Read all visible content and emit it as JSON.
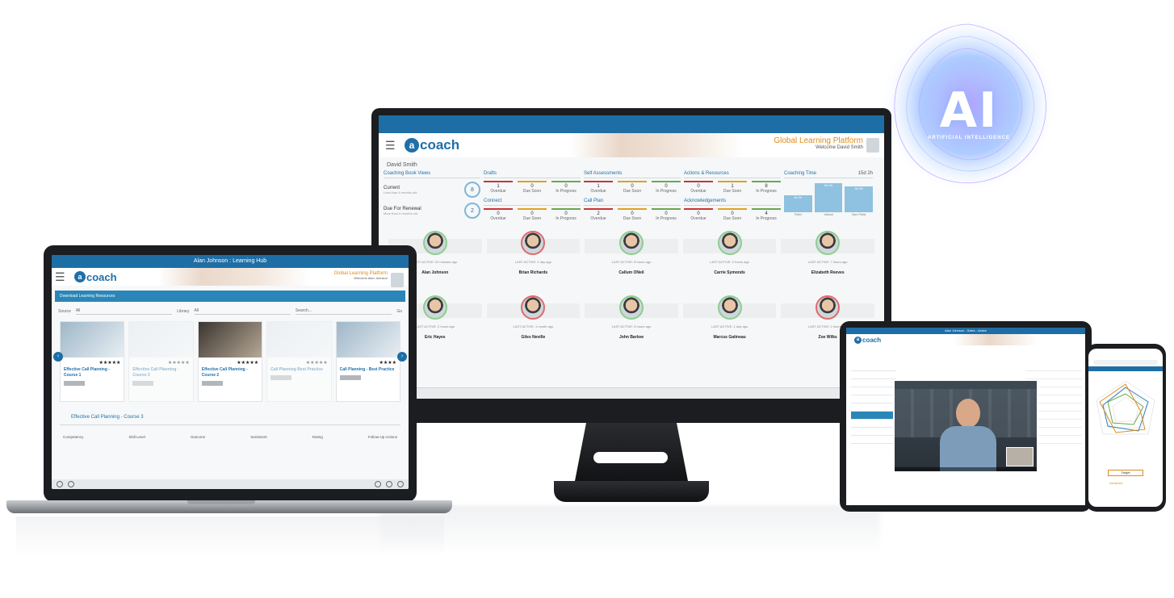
{
  "ai_badge": {
    "text": "AI",
    "subtitle": "ARTIFICIAL INTELLIGENCE"
  },
  "monitor": {
    "brand": {
      "logo_letter": "a",
      "logo_text": "coach",
      "platform": "Global Learning Platform",
      "welcome": "Welcome David Smith"
    },
    "user": "David Smith",
    "coaching_book": {
      "title": "Coaching Book Views",
      "items": [
        {
          "label": "Current",
          "sub": "Less than 6 months old",
          "count": "8"
        },
        {
          "label": "Due For Renewal",
          "sub": "More than 6 months old",
          "count": "2"
        }
      ]
    },
    "panels": [
      {
        "title": "Drafts",
        "stats": [
          {
            "n": "1",
            "l": "Overdue"
          },
          {
            "n": "0",
            "l": "Due Soon"
          },
          {
            "n": "0",
            "l": "In Progress"
          }
        ]
      },
      {
        "title": "Self Assessments",
        "stats": [
          {
            "n": "1",
            "l": "Overdue"
          },
          {
            "n": "0",
            "l": "Due Soon"
          },
          {
            "n": "0",
            "l": "In Progress"
          }
        ]
      },
      {
        "title": "Actions & Resources",
        "stats": [
          {
            "n": "0",
            "l": "Overdue"
          },
          {
            "n": "1",
            "l": "Due Soon"
          },
          {
            "n": "8",
            "l": "In Progress"
          }
        ]
      },
      {
        "title": "Connect",
        "stats": [
          {
            "n": "0",
            "l": "Overdue"
          },
          {
            "n": "0",
            "l": "Due Soon"
          },
          {
            "n": "0",
            "l": "In Progress"
          }
        ]
      },
      {
        "title": "Call Plan",
        "stats": [
          {
            "n": "2",
            "l": "Overdue"
          },
          {
            "n": "0",
            "l": "Due Soon"
          },
          {
            "n": "0",
            "l": "In Progress"
          }
        ]
      },
      {
        "title": "Acknowledgements",
        "stats": [
          {
            "n": "0",
            "l": "Overdue"
          },
          {
            "n": "0",
            "l": "Due Soon"
          },
          {
            "n": "4",
            "l": "In Progress"
          }
        ]
      }
    ],
    "coaching_time": {
      "title": "Coaching Time",
      "total": "15d 2h",
      "bars": [
        {
          "label": "Field",
          "value": "4d 2h",
          "level": 0.55
        },
        {
          "label": "Virtual",
          "value": "5d 9h",
          "level": 0.95
        },
        {
          "label": "Non Field",
          "value": "5d 3h",
          "level": 0.85
        }
      ]
    },
    "people": [
      {
        "name": "Alan Johnson",
        "last": "LAST ACTIVE: 22 minutes ago",
        "alert": false
      },
      {
        "name": "Brian Richards",
        "last": "LAST ACTIVE: 1 day ago",
        "alert": true
      },
      {
        "name": "Callum ONeil",
        "last": "LAST ACTIVE: 8 hours ago",
        "alert": false
      },
      {
        "name": "Carrie Symonds",
        "last": "LAST ACTIVE: 2 hours ago",
        "alert": false
      },
      {
        "name": "Elizabeth Reeves",
        "last": "LAST ACTIVE: 7 hours ago",
        "alert": false
      },
      {
        "name": "Eric Hayes",
        "last": "LAST ACTIVE: 2 hours ago",
        "alert": false
      },
      {
        "name": "Giles Neville",
        "last": "LAST ACTIVE: 1 month ago",
        "alert": true
      },
      {
        "name": "John Barlow",
        "last": "LAST ACTIVE: 5 hours ago",
        "alert": false
      },
      {
        "name": "Marcus Gatineau",
        "last": "LAST ACTIVE: 1 day ago",
        "alert": false
      },
      {
        "name": "Zoe Wilks",
        "last": "LAST ACTIVE: 2 hours ago",
        "alert": true
      }
    ]
  },
  "laptop": {
    "title": "Alan Johnson : Learning Hub",
    "brand": {
      "logo_letter": "a",
      "logo_text": "coach",
      "platform": "Global Learning Platform",
      "welcome": "Welcome Alan Johnson"
    },
    "section": "Download Learning Resources",
    "filters": {
      "source_label": "Source",
      "source_value": "All",
      "library_label": "Library",
      "library_value": "All",
      "search": "Search...",
      "go": "Go"
    },
    "cards": [
      {
        "title": "Effective Call Planning - Course 1",
        "stars": "★★★★★",
        "img": "blue",
        "faded": false
      },
      {
        "title": "Effective Call Planning - Course 2",
        "stars": "★★★★★",
        "img": "light",
        "faded": true
      },
      {
        "title": "Effective Call Planning - Course 2",
        "stars": "★★★★★",
        "img": "dark",
        "faded": false
      },
      {
        "title": "Call Planning Best Practice",
        "stars": "★★★★★",
        "img": "light",
        "faded": true
      },
      {
        "title": "Call Planning - Best Practice",
        "stars": "★★★★",
        "img": "blue",
        "faded": false
      }
    ],
    "subheading": "Effective Call Planning - Course 3",
    "columns": [
      "Competency",
      "Skill Level",
      "Outcome",
      "Sentiment",
      "Rating",
      "Follow-Up Actions"
    ]
  },
  "tablet": {
    "title": "Alan Johnson : Sales - Active",
    "brand": {
      "logo_letter": "a",
      "logo_text": "coach"
    }
  },
  "phone": {
    "button": "Target",
    "text": "Achieved"
  }
}
